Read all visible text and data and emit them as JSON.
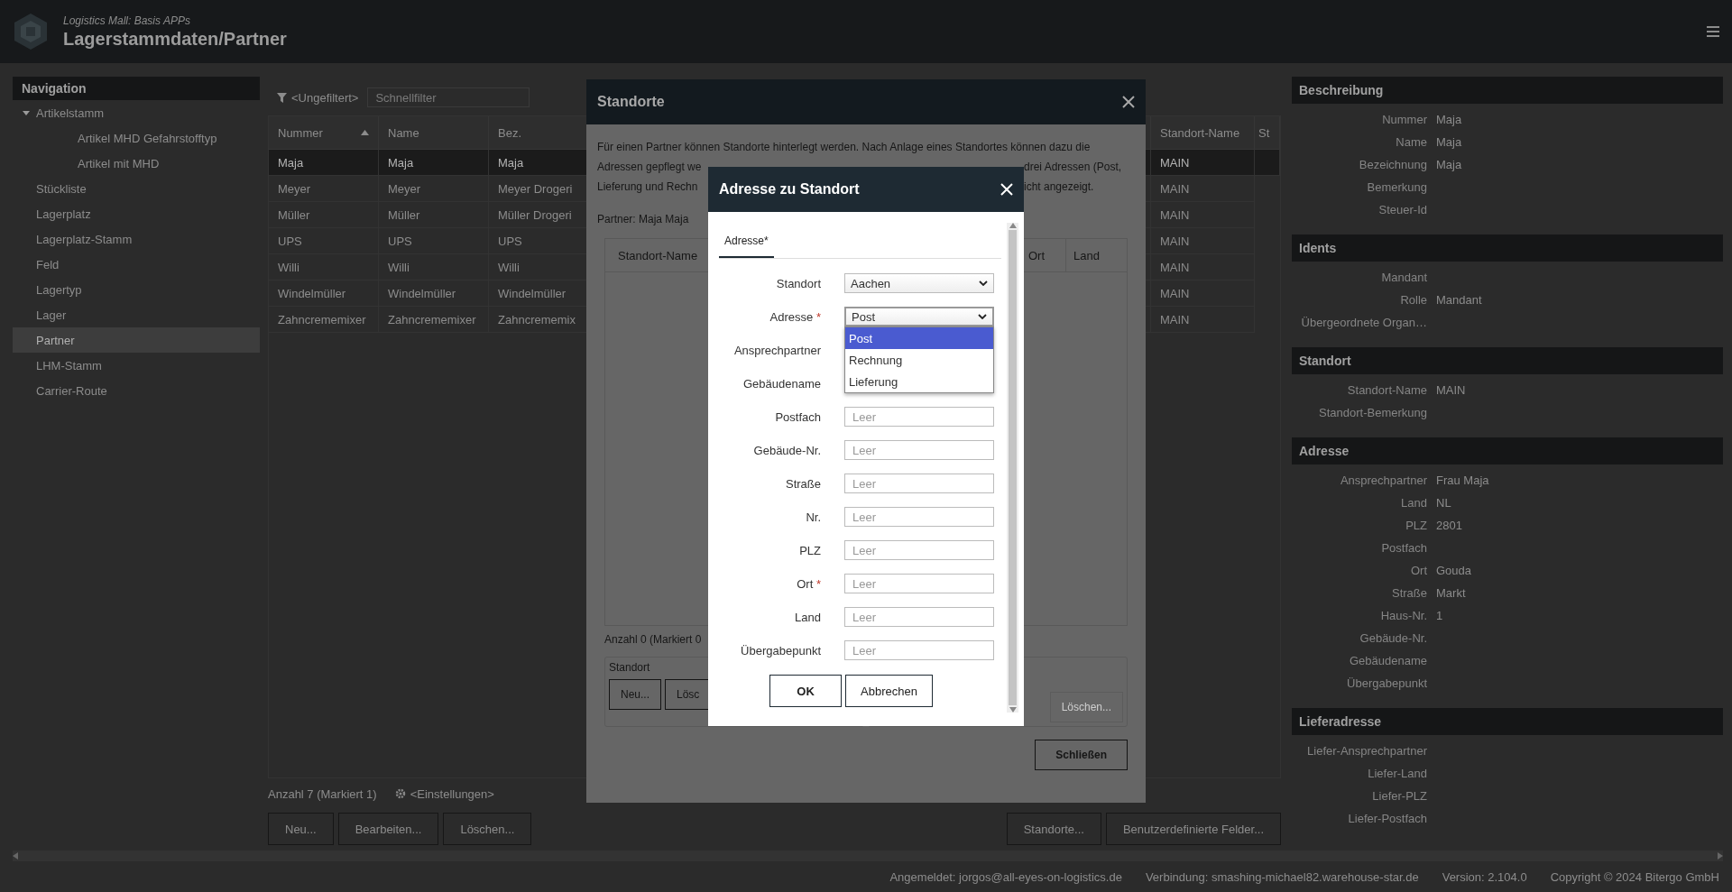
{
  "app": {
    "subtitle": "Logistics Mall: Basis APPs",
    "title": "Lagerstammdaten/Partner"
  },
  "navigation": {
    "title": "Navigation",
    "items": [
      {
        "label": "Artikelstamm",
        "selected": false,
        "expanded": true,
        "children": [
          {
            "label": "Artikel MHD Gefahrstofftyp",
            "selected": false
          },
          {
            "label": "Artikel mit MHD",
            "selected": false
          }
        ]
      },
      {
        "label": "Stückliste",
        "selected": false
      },
      {
        "label": "Lagerplatz",
        "selected": false
      },
      {
        "label": "Lagerplatz-Stamm",
        "selected": false
      },
      {
        "label": "Feld",
        "selected": false
      },
      {
        "label": "Lagertyp",
        "selected": false
      },
      {
        "label": "Lager",
        "selected": false
      },
      {
        "label": "Partner",
        "selected": true
      },
      {
        "label": "LHM-Stamm",
        "selected": false
      },
      {
        "label": "Carrier-Route",
        "selected": false
      }
    ]
  },
  "main": {
    "filter": "<Ungefiltert>",
    "quick_filter_placeholder": "Schnellfilter",
    "columns": [
      {
        "label": "Nummer",
        "sorted": true
      },
      {
        "label": "Name",
        "sorted": false
      },
      {
        "label": "Bez.",
        "sorted": false
      },
      {
        "label": "Standort-Name",
        "sorted": false
      },
      {
        "label": "St",
        "sorted": false
      }
    ],
    "rows": [
      {
        "cells": [
          "Maja",
          "Maja",
          "Maja",
          "MAIN"
        ],
        "selected": true
      },
      {
        "cells": [
          "Meyer",
          "Meyer",
          "Meyer Drogeri",
          "MAIN"
        ],
        "selected": false
      },
      {
        "cells": [
          "Müller",
          "Müller",
          "Müller Drogeri",
          "MAIN"
        ],
        "selected": false
      },
      {
        "cells": [
          "UPS",
          "UPS",
          "UPS",
          "MAIN"
        ],
        "selected": false
      },
      {
        "cells": [
          "Willi",
          "Willi",
          "Willi",
          "MAIN"
        ],
        "selected": false
      },
      {
        "cells": [
          "Windelmüller",
          "Windelmüller",
          "Windelmüller",
          "MAIN"
        ],
        "selected": false
      },
      {
        "cells": [
          "Zahncrememixer",
          "Zahncrememixer",
          "Zahncrememix",
          "MAIN"
        ],
        "selected": false
      }
    ],
    "count": "Anzahl 7 (Markiert 1)",
    "settings": "<Einstellungen>",
    "buttons": [
      "Neu...",
      "Bearbeiten...",
      "Löschen..."
    ],
    "right_buttons": [
      "Standorte...",
      "Benutzerdefinierte Felder..."
    ]
  },
  "details": [
    {
      "title": "Beschreibung",
      "fields": [
        {
          "label": "Nummer",
          "value": "Maja"
        },
        {
          "label": "Name",
          "value": "Maja"
        },
        {
          "label": "Bezeichnung",
          "value": "Maja"
        },
        {
          "label": "Bemerkung"
        },
        {
          "label": "Steuer-Id"
        }
      ]
    },
    {
      "title": "Idents",
      "fields": [
        {
          "label": "Mandant"
        },
        {
          "label": "Rolle",
          "value": "Mandant"
        },
        {
          "label": "Übergeordnete Organ…"
        }
      ]
    },
    {
      "title": "Standort",
      "fields": [
        {
          "label": "Standort-Name",
          "value": "MAIN"
        },
        {
          "label": "Standort-Bemerkung"
        }
      ]
    },
    {
      "title": "Adresse",
      "fields": [
        {
          "label": "Ansprechpartner",
          "value": "Frau Maja"
        },
        {
          "label": "Land",
          "value": "NL"
        },
        {
          "label": "PLZ",
          "value": "2801"
        },
        {
          "label": "Postfach"
        },
        {
          "label": "Ort",
          "value": "Gouda"
        },
        {
          "label": "Straße",
          "value": "Markt"
        },
        {
          "label": "Haus-Nr.",
          "value": "1"
        },
        {
          "label": "Gebäude-Nr."
        },
        {
          "label": "Gebäudename"
        },
        {
          "label": "Übergabepunkt"
        }
      ]
    },
    {
      "title": "Lieferadresse",
      "fields": [
        {
          "label": "Liefer-Ansprechpartner"
        },
        {
          "label": "Liefer-Land"
        },
        {
          "label": "Liefer-PLZ"
        },
        {
          "label": "Liefer-Postfach"
        }
      ]
    }
  ],
  "status_bar": [
    "Angemeldet: jorgos@all-eyes-on-logistics.de",
    "Verbindung: smashing-michael82.warehouse-star.de",
    "Version: 2.104.0",
    "Copyright © 2024 Bitergo GmbH"
  ],
  "standorte_dialog": {
    "title": "Standorte",
    "intro_line_1": "Für einen Partner können Standorte hinterlegt werden. Nach Anlage eines Standortes können dazu die",
    "intro_line_2_start": "Adressen gepflegt we",
    "intro_line_2_end": "drei Adressen (Post,",
    "intro_line_3_start": "Lieferung und Rechn",
    "intro_line_3_end": "icht angezeigt.",
    "partner": "Partner: Maja Maja",
    "column_left": "Standort-Name",
    "columns_right": [
      "Ort",
      "Land"
    ],
    "count": "Anzahl 0 (Markiert 0",
    "group_title": "Standort",
    "group_buttons": [
      "Neu...",
      "Lösc"
    ],
    "address_buttons": [
      {
        "label": "Löschen...",
        "disabled": true
      }
    ],
    "close_button": "Schließen"
  },
  "address_dialog": {
    "title": "Adresse zu Standort",
    "tab": {
      "label": "Adresse*",
      "selected": true
    },
    "fields": [
      {
        "label": "Standort",
        "kind": "select",
        "value": "Aachen",
        "open": false
      },
      {
        "label": "Adresse",
        "required_mark": "*",
        "kind": "select",
        "value": "Post",
        "open": true,
        "options": [
          {
            "label": "Post",
            "selected": true
          },
          {
            "label": "Rechnung",
            "selected": false
          },
          {
            "label": "Lieferung",
            "selected": false
          }
        ]
      },
      {
        "label": "Ansprechpartner",
        "kind": "text"
      },
      {
        "label": "Gebäudename",
        "kind": "text"
      },
      {
        "label": "Postfach",
        "kind": "text",
        "placeholder": "Leer"
      },
      {
        "label": "Gebäude-Nr.",
        "kind": "text",
        "placeholder": "Leer"
      },
      {
        "label": "Straße",
        "kind": "text",
        "placeholder": "Leer"
      },
      {
        "label": "Nr.",
        "kind": "text",
        "placeholder": "Leer"
      },
      {
        "label": "PLZ",
        "kind": "text",
        "placeholder": "Leer"
      },
      {
        "label": "Ort",
        "required_mark": "*",
        "kind": "text",
        "placeholder": "Leer"
      },
      {
        "label": "Land",
        "kind": "text",
        "placeholder": "Leer"
      },
      {
        "label": "Übergabepunkt",
        "kind": "text",
        "placeholder": "Leer"
      }
    ],
    "buttons": [
      {
        "label": "OK",
        "kind": "primary"
      },
      {
        "label": "Abbrechen",
        "kind": "secondary"
      }
    ]
  }
}
